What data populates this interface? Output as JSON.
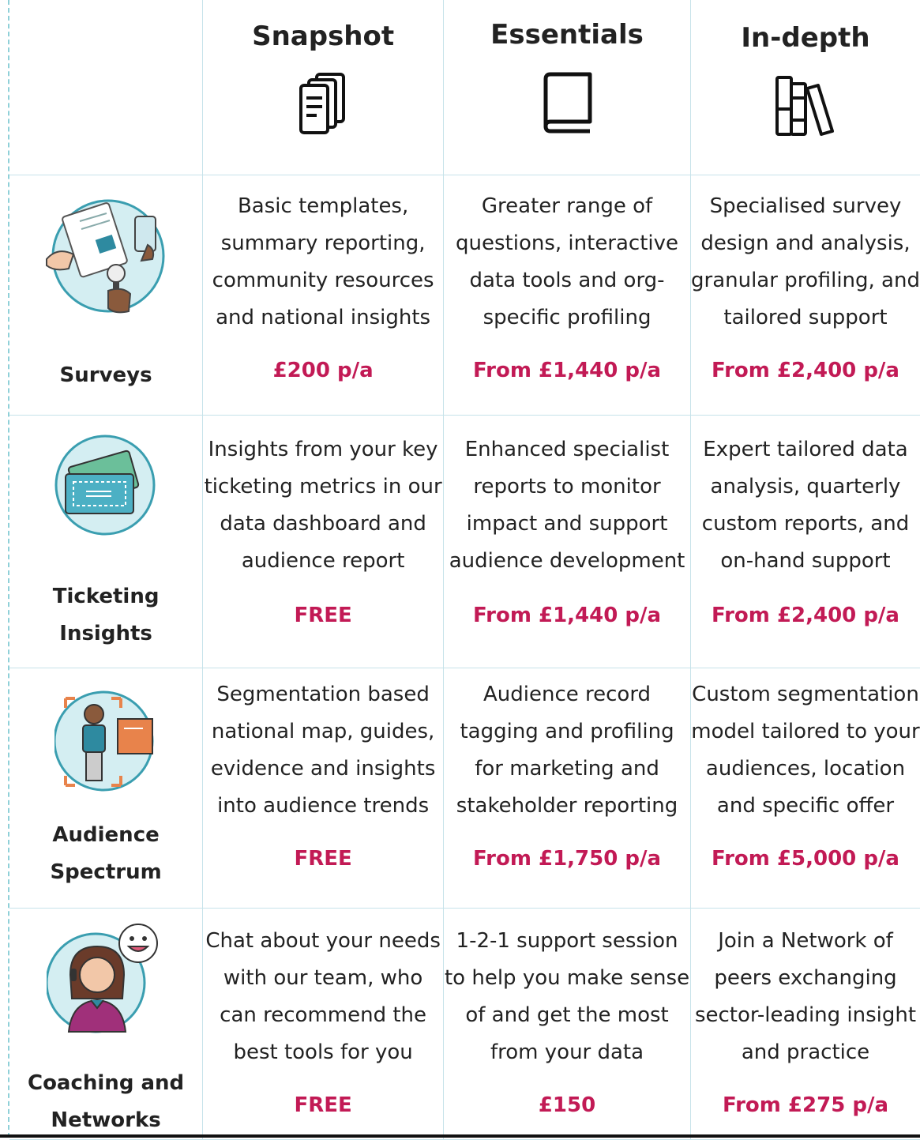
{
  "columns": [
    "Snapshot",
    "Essentials",
    "In-depth"
  ],
  "header_icons": [
    "documents-icon",
    "book-icon",
    "books-icon"
  ],
  "rows": [
    {
      "label": [
        "Surveys"
      ],
      "icon": "survey-illustration-icon",
      "cells": [
        {
          "lines": [
            "Basic templates,",
            "summary reporting,",
            "community resources",
            "and national insights"
          ],
          "price": "£200 p/a"
        },
        {
          "lines": [
            "Greater range of",
            "questions, interactive",
            "data tools and org-",
            "specific profiling"
          ],
          "price": "From £1,440 p/a"
        },
        {
          "lines": [
            "Specialised survey",
            "design and analysis,",
            "granular profiling, and",
            "tailored support"
          ],
          "price": "From £2,400 p/a"
        }
      ]
    },
    {
      "label": [
        "Ticketing",
        "Insights"
      ],
      "icon": "tickets-illustration-icon",
      "cells": [
        {
          "lines": [
            "Insights from your key",
            "ticketing metrics in our",
            "data dashboard and",
            "audience report"
          ],
          "price": "FREE"
        },
        {
          "lines": [
            "Enhanced specialist",
            "reports to monitor",
            "impact and support",
            "audience development"
          ],
          "price": "From £1,440 p/a"
        },
        {
          "lines": [
            "Expert tailored data",
            "analysis, quarterly",
            "custom reports, and",
            "on-hand support"
          ],
          "price": "From £2,400 p/a"
        }
      ]
    },
    {
      "label": [
        "Audience",
        "Spectrum"
      ],
      "icon": "person-profile-illustration-icon",
      "cells": [
        {
          "lines": [
            "Segmentation based",
            "national map, guides,",
            "evidence and insights",
            "into audience trends"
          ],
          "price": "FREE"
        },
        {
          "lines": [
            "Audience record",
            "tagging and profiling",
            "for marketing and",
            "stakeholder reporting"
          ],
          "price": "From £1,750 p/a"
        },
        {
          "lines": [
            "Custom segmentation",
            "model tailored to your",
            "audiences, location",
            "and specific offer"
          ],
          "price": "From £5,000 p/a"
        }
      ]
    },
    {
      "label": [
        "Coaching and",
        "Networks"
      ],
      "icon": "headset-coach-illustration-icon",
      "cells": [
        {
          "lines": [
            "Chat about your needs",
            "with our team, who",
            "can recommend the",
            "best tools for you"
          ],
          "price": "FREE"
        },
        {
          "lines": [
            "1-2-1 support session",
            "to help you make sense",
            "of and get the most",
            "from your data"
          ],
          "price": "£150"
        },
        {
          "lines": [
            "Join a Network of",
            "peers exchanging",
            "sector-leading insight",
            "and practice"
          ],
          "price": "From £275 p/a"
        }
      ]
    }
  ],
  "colors": {
    "price": "#c21a55",
    "grid": "#c7e3ea",
    "icon_circle": "#d4eef2",
    "icon_circle_border": "#3a9eb0"
  }
}
